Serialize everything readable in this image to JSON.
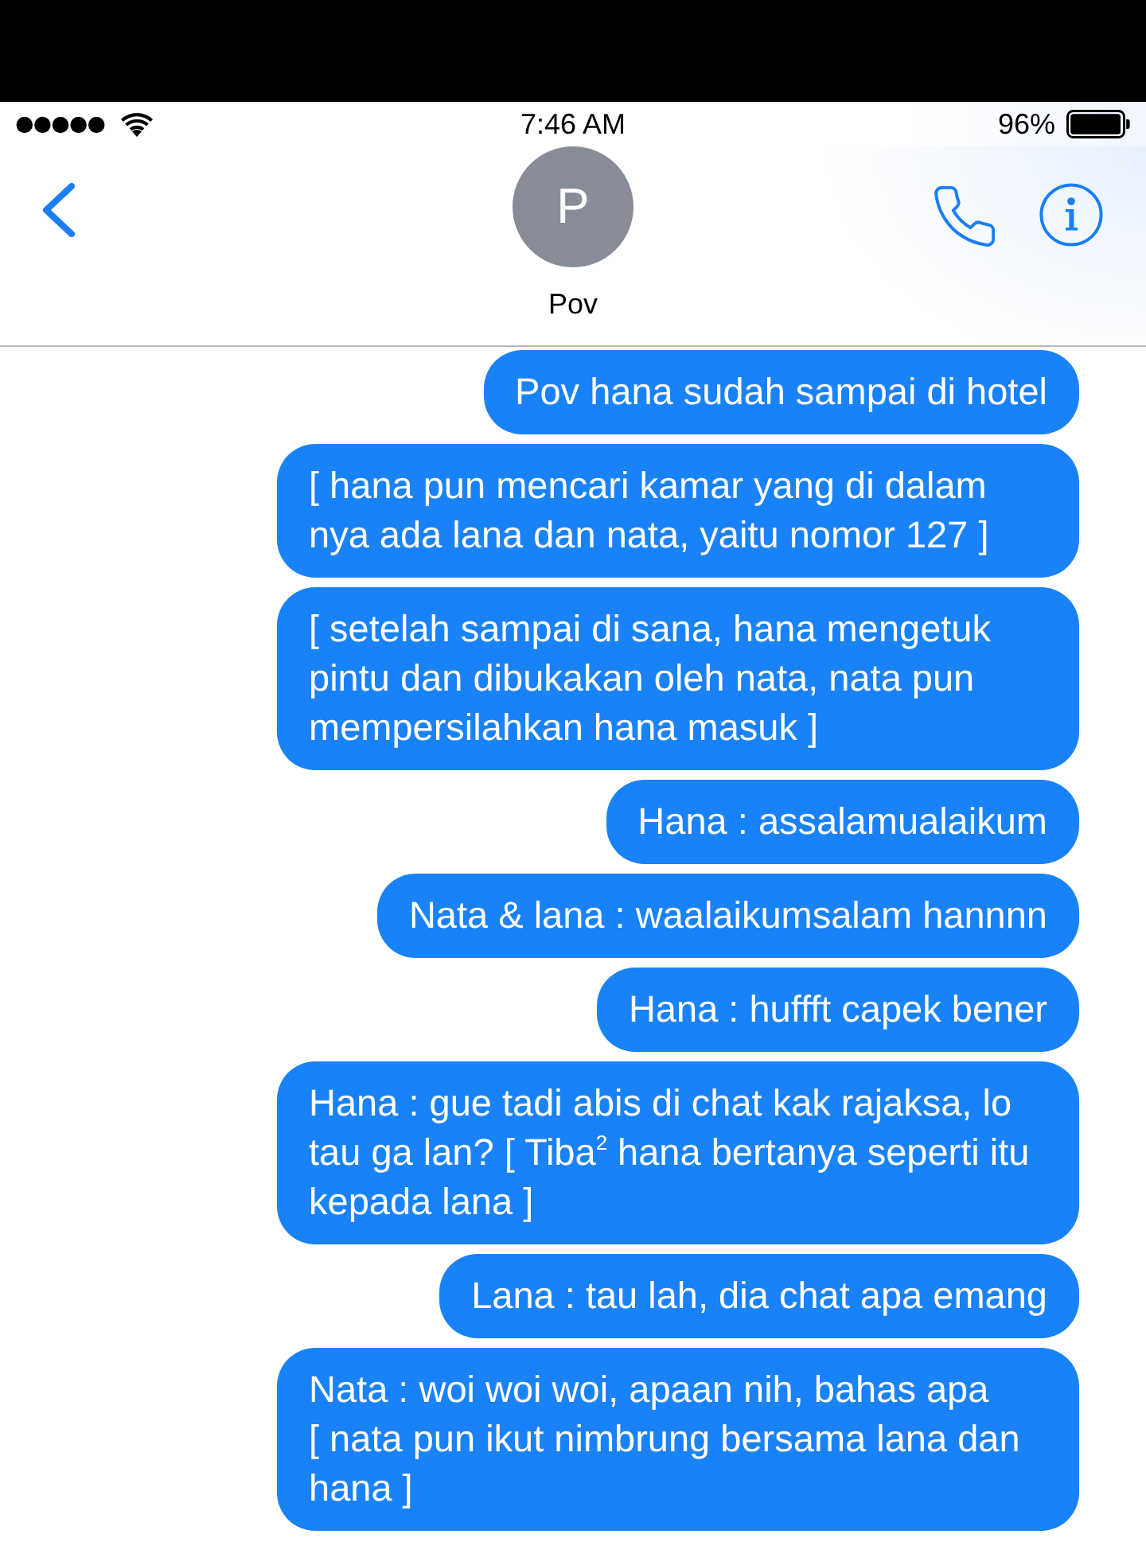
{
  "status_bar": {
    "time": "7:46 AM",
    "battery": "96%"
  },
  "header": {
    "avatar_initial": "P",
    "contact_name": "Pov"
  },
  "messages": [
    {
      "text": "Pov hana sudah sampai di hotel"
    },
    {
      "text": "[ hana pun mencari kamar yang di dalam nya ada lana dan nata, yaitu nomor 127 ]"
    },
    {
      "text": "[ setelah sampai di sana, hana mengetuk pintu dan dibukakan oleh nata, nata pun mempersilahkan hana masuk ]"
    },
    {
      "text": "Hana : assalamualaikum"
    },
    {
      "text": "Nata & lana : waalaikumsalam hannnn"
    },
    {
      "text": "Hana : huffft capek bener"
    },
    {
      "text": "Hana : gue tadi abis di chat kak rajaksa, lo tau ga lan? [ Tiba$^{2}$ hana bertanya seperti itu kepada lana ]"
    },
    {
      "text": "Lana : tau lah, dia chat apa emang"
    },
    {
      "text": "Nata : woi woi woi, apaan nih, bahas apa\n[ nata pun ikut nimbrung bersama lana dan hana ]"
    }
  ]
}
